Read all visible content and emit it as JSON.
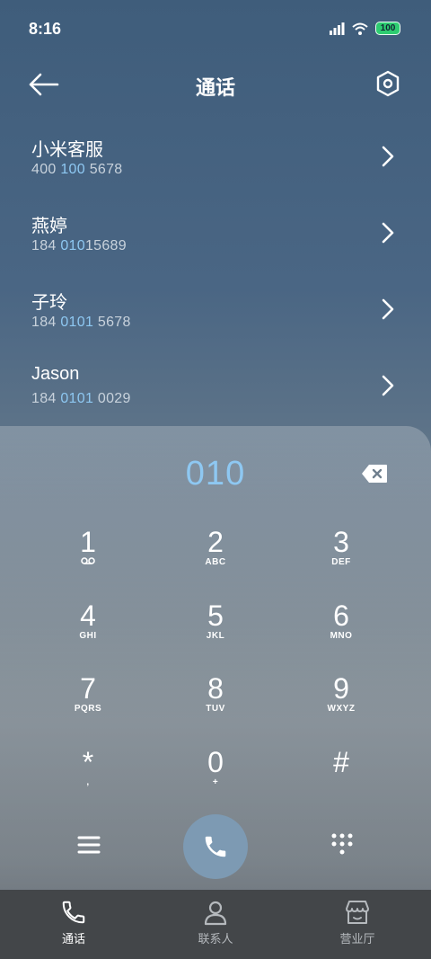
{
  "status": {
    "time": "8:16",
    "battery": "100"
  },
  "header": {
    "title": "通话"
  },
  "contacts": [
    {
      "name": "小米客服",
      "number_parts": [
        "400 ",
        "100",
        " 5678"
      ]
    },
    {
      "name": "燕婷",
      "number_parts": [
        "184 ",
        "010",
        "15689"
      ]
    },
    {
      "name": "子玲",
      "number_parts": [
        "184 ",
        "0101",
        " 5678"
      ]
    },
    {
      "name": "Jason",
      "number_parts": [
        "184 ",
        "0101",
        " 0029"
      ]
    }
  ],
  "dialer": {
    "typed": "010",
    "keys": [
      {
        "digit": "1",
        "sub": ""
      },
      {
        "digit": "2",
        "sub": "ABC"
      },
      {
        "digit": "3",
        "sub": "DEF"
      },
      {
        "digit": "4",
        "sub": "GHI"
      },
      {
        "digit": "5",
        "sub": "JKL"
      },
      {
        "digit": "6",
        "sub": "MNO"
      },
      {
        "digit": "7",
        "sub": "PQRS"
      },
      {
        "digit": "8",
        "sub": "TUV"
      },
      {
        "digit": "9",
        "sub": "WXYZ"
      },
      {
        "digit": "*",
        "sub": ","
      },
      {
        "digit": "0",
        "sub": "+"
      },
      {
        "digit": "#",
        "sub": ""
      }
    ]
  },
  "nav": {
    "items": [
      {
        "label": "通话",
        "icon": "phone-icon",
        "active": true
      },
      {
        "label": "联系人",
        "icon": "person-icon",
        "active": false
      },
      {
        "label": "营业厅",
        "icon": "store-icon",
        "active": false
      }
    ]
  },
  "colors": {
    "accent": "#8ec8f2",
    "call_button": "#7d9ab3",
    "nav_bg": "#434649"
  }
}
